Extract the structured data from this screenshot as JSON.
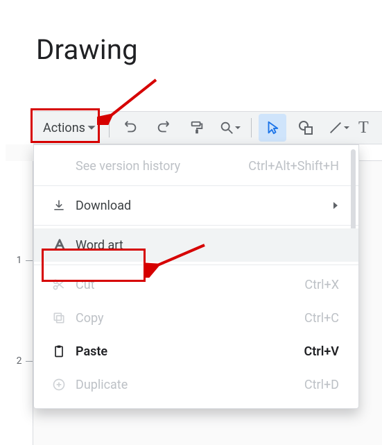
{
  "title": "Drawing",
  "toolbar": {
    "actions_label": "Actions"
  },
  "menu": {
    "version_history": {
      "label": "See version history",
      "shortcut": "Ctrl+Alt+Shift+H"
    },
    "download": {
      "label": "Download"
    },
    "word_art": {
      "label": "Word art"
    },
    "cut": {
      "label": "Cut",
      "shortcut": "Ctrl+X"
    },
    "copy": {
      "label": "Copy",
      "shortcut": "Ctrl+C"
    },
    "paste": {
      "label": "Paste",
      "shortcut": "Ctrl+V"
    },
    "duplicate": {
      "label": "Duplicate",
      "shortcut": "Ctrl+D"
    }
  },
  "ruler": {
    "one": "1",
    "two": "2"
  }
}
